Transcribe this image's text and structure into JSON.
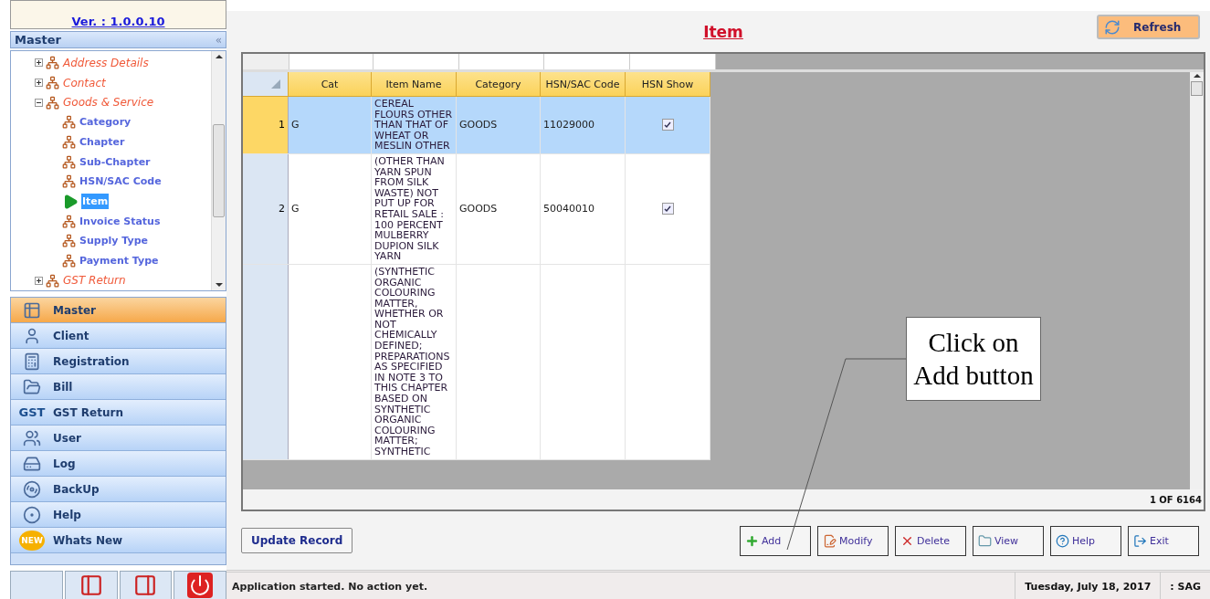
{
  "app": {
    "version": "Ver. : 1.0.0.10"
  },
  "master_panel": {
    "title": "Master",
    "collapse_glyph": "«"
  },
  "tree": [
    {
      "label": "Address Details",
      "expanded": false,
      "selected": false
    },
    {
      "label": "Contact",
      "expanded": false,
      "selected": false
    },
    {
      "label": "Goods & Service",
      "expanded": true,
      "selected": false,
      "children": [
        {
          "label": "Category",
          "selected": false
        },
        {
          "label": "Chapter",
          "selected": false
        },
        {
          "label": "Sub-Chapter",
          "selected": false
        },
        {
          "label": "HSN/SAC Code",
          "selected": false
        },
        {
          "label": "Item",
          "selected": true
        },
        {
          "label": "Invoice Status",
          "selected": false
        },
        {
          "label": "Supply Type",
          "selected": false
        },
        {
          "label": "Payment Type",
          "selected": false
        }
      ]
    },
    {
      "label": "GST Return",
      "expanded": false,
      "selected": false
    }
  ],
  "nav": [
    {
      "label": "Master",
      "selected": true
    },
    {
      "label": "Client",
      "selected": false
    },
    {
      "label": "Registration",
      "selected": false
    },
    {
      "label": "Bill",
      "selected": false
    },
    {
      "label": "GST Return",
      "selected": false,
      "badge": "GST"
    },
    {
      "label": "User",
      "selected": false
    },
    {
      "label": "Log",
      "selected": false
    },
    {
      "label": "BackUp",
      "selected": false
    },
    {
      "label": "Help",
      "selected": false
    },
    {
      "label": "Whats New",
      "selected": false,
      "badge": "NEW"
    }
  ],
  "page": {
    "title": "Item",
    "refresh": "Refresh"
  },
  "table": {
    "columns": [
      "Cat",
      "Item Name",
      "Category",
      "HSN/SAC Code",
      "HSN Show"
    ],
    "rows": [
      {
        "number": "1",
        "cat": "G",
        "item_name": "CEREAL FLOURS OTHER THAN THAT OF WHEAT OR MESLIN OTHER",
        "category": "GOODS",
        "code": "11029000",
        "hsn_show": true,
        "selected": true
      },
      {
        "number": "2",
        "cat": "G",
        "item_name": "(OTHER THAN YARN SPUN FROM SILK WASTE) NOT PUT UP FOR RETAIL SALE : 100 PERCENT MULBERRY DUPION SILK YARN",
        "category": "GOODS",
        "code": "50040010",
        "hsn_show": true,
        "selected": false
      },
      {
        "item_name": "(SYNTHETIC ORGANIC COLOURING MATTER, WHETHER OR NOT CHEMICALLY DEFINED; PREPARATIONS AS SPECIFIED IN NOTE 3 TO THIS CHAPTER BASED ON SYNTHETIC ORGANIC COLOURING MATTER; SYNTHETIC",
        "selected": false
      }
    ],
    "counter": "1 OF 6164"
  },
  "update_button": "Update Record",
  "actions": [
    "Add",
    "Modify",
    "Delete",
    "View",
    "Help",
    "Exit"
  ],
  "callout": "Click on Add button",
  "status_bar": {
    "message": "Application started. No action yet.",
    "date": "Tuesday, July 18, 2017",
    "user": ": SAG"
  }
}
